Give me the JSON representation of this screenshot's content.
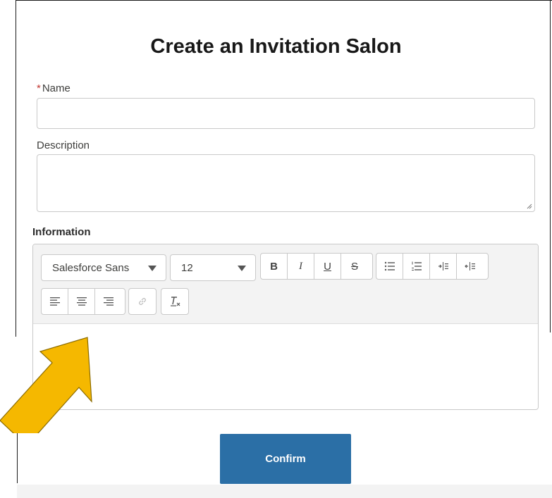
{
  "page": {
    "title": "Create an Invitation Salon"
  },
  "form": {
    "name_required_marker": "*",
    "name_label": "Name",
    "name_value": "",
    "description_label": "Description",
    "description_value": "",
    "information_label": "Information",
    "information_value": ""
  },
  "toolbar": {
    "font_family": "Salesforce Sans",
    "font_size": "12",
    "bold_label": "B",
    "italic_label": "I",
    "underline_label": "U",
    "strike_label": "S",
    "icons": [
      "bullet-list-icon",
      "numbered-list-icon",
      "indent-icon",
      "outdent-icon",
      "align-left-icon",
      "align-center-icon",
      "align-right-icon",
      "link-icon",
      "clear-format-icon"
    ]
  },
  "actions": {
    "confirm_label": "Confirm"
  },
  "colors": {
    "accent": "#2b6fa6",
    "required": "#c23934",
    "arrow": "#f5b800"
  }
}
